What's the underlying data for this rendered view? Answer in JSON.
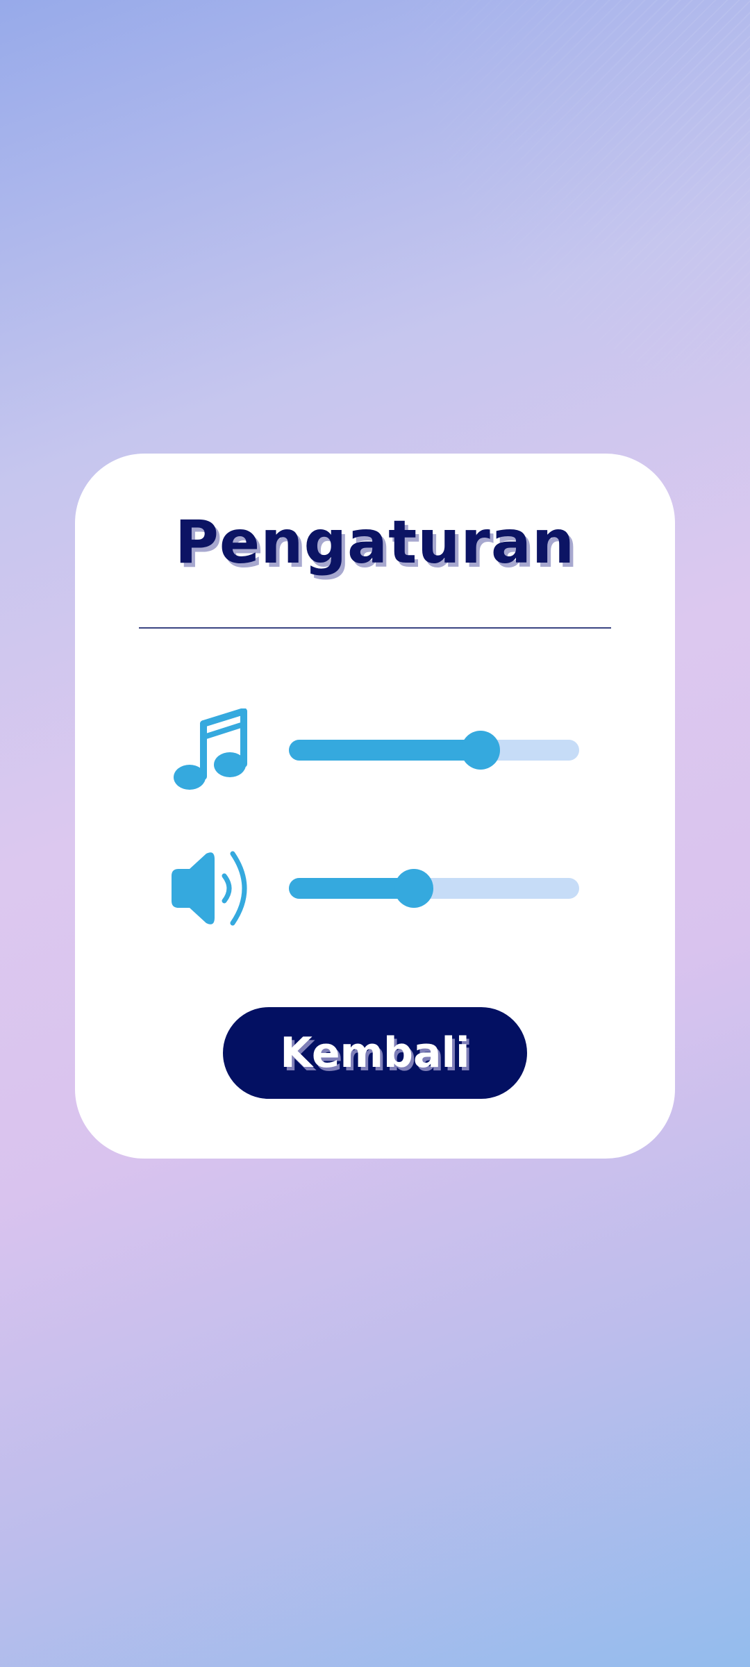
{
  "settings": {
    "title": "Pengaturan",
    "music": {
      "icon": "music-note-icon",
      "volume": 0.66
    },
    "sound": {
      "icon": "speaker-icon",
      "volume": 0.43
    },
    "back_label": "Kembali"
  },
  "colors": {
    "title": "#0c1464",
    "slider_fill": "#35a9de",
    "slider_track": "#c6dcf7",
    "button": "#031062"
  }
}
